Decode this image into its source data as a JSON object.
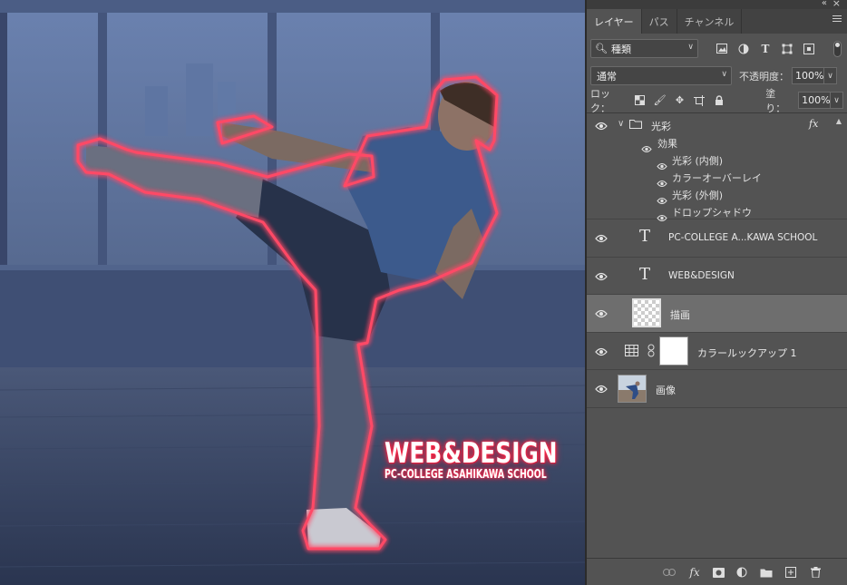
{
  "canvas": {
    "watermark_title": "WEB&DESIGN",
    "watermark_subtitle": "PC-COLLEGE ASAHIKAWA SCHOOL"
  },
  "panel": {
    "tabs": [
      {
        "label": "レイヤー",
        "active": true
      },
      {
        "label": "パス",
        "active": false
      },
      {
        "label": "チャンネル",
        "active": false
      }
    ],
    "filter": {
      "label": "種類"
    },
    "blend_mode": "通常",
    "opacity_label": "不透明度：",
    "opacity_value": "100%",
    "lock_label": "ロック：",
    "fill_label": "塗り：",
    "fill_value": "100%"
  },
  "layers": [
    {
      "name": "光彩",
      "type": "group",
      "fx": "fx",
      "effects_label": "効果",
      "effects": [
        "光彩 (内側)",
        "カラーオーバーレイ",
        "光彩 (外側)",
        "ドロップシャドウ"
      ]
    },
    {
      "name": "PC-COLLEGE A...KAWA SCHOOL",
      "type": "text",
      "glyph": "T"
    },
    {
      "name": "WEB&DESIGN",
      "type": "text",
      "glyph": "T"
    },
    {
      "name": "描画",
      "type": "pixel",
      "selected": true
    },
    {
      "name": "カラールックアップ 1",
      "type": "adjustment"
    },
    {
      "name": "画像",
      "type": "image"
    }
  ],
  "colors": {
    "panel_bg": "#535353",
    "selected_row": "#6e6e6e",
    "neon": "#ff2040"
  }
}
